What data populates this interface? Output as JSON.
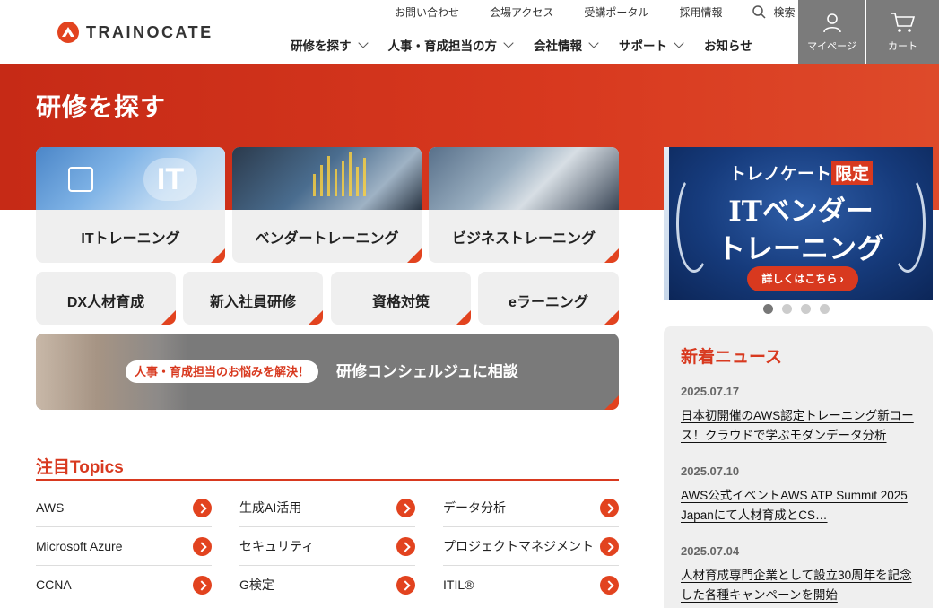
{
  "header": {
    "logo_text": "TRAINOCATE",
    "util_links": [
      "お問い合わせ",
      "会場アクセス",
      "受講ポータル",
      "採用情報"
    ],
    "search_label": "検索",
    "nav": [
      "研修を探す",
      "人事・育成担当の方",
      "会社情報",
      "サポート",
      "お知らせ"
    ],
    "mypage_label": "マイページ",
    "cart_label": "カート"
  },
  "hero": {
    "title": "研修を探す"
  },
  "cards": {
    "big": [
      "ITトレーニング",
      "ベンダートレーニング",
      "ビジネストレーニング"
    ],
    "small": [
      "DX人材育成",
      "新入社員研修",
      "資格対策",
      "eラーニング"
    ],
    "it_image_text": "IT"
  },
  "consult": {
    "pill": "人事・育成担当のお悩みを解決！",
    "text": "研修コンシェルジュに相談"
  },
  "topics": {
    "title": "注目Topics",
    "items": [
      [
        "AWS",
        "生成AI活用",
        "データ分析"
      ],
      [
        "Microsoft Azure",
        "セキュリティ",
        "プロジェクトマネジメント"
      ],
      [
        "CCNA",
        "G検定",
        "ITIL®"
      ]
    ]
  },
  "promo": {
    "line1_prefix": "トレノケート",
    "line1_tag": "限定",
    "line2": "ITベンダー",
    "line3": "トレーニング",
    "button": "詳しくはこちら ›"
  },
  "carousel": {
    "count": 4,
    "active": 0
  },
  "news": {
    "title": "新着ニュース",
    "items": [
      {
        "date": "2025.07.17",
        "text": "日本初開催のAWS認定トレーニング新コース！クラウドで学ぶモダンデータ分析"
      },
      {
        "date": "2025.07.10",
        "text": "AWS公式イベントAWS ATP Summit 2025 Japanにて人材育成とCS…"
      },
      {
        "date": "2025.07.04",
        "text": "人材育成専門企業として設立30周年を記念した各種キャンペーンを開始"
      }
    ]
  },
  "colors": {
    "accent": "#d8391f",
    "card_bg": "#efefef",
    "header_button": "#7b7b7b"
  }
}
